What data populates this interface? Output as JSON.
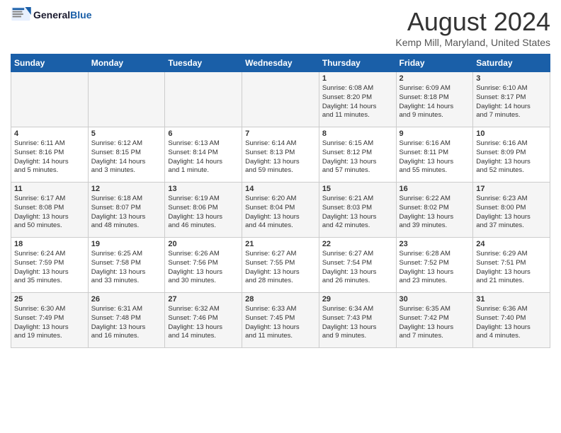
{
  "header": {
    "logo_line1": "General",
    "logo_line2": "Blue",
    "month_year": "August 2024",
    "location": "Kemp Mill, Maryland, United States"
  },
  "weekdays": [
    "Sunday",
    "Monday",
    "Tuesday",
    "Wednesday",
    "Thursday",
    "Friday",
    "Saturday"
  ],
  "weeks": [
    [
      {
        "day": "",
        "info": ""
      },
      {
        "day": "",
        "info": ""
      },
      {
        "day": "",
        "info": ""
      },
      {
        "day": "",
        "info": ""
      },
      {
        "day": "1",
        "info": "Sunrise: 6:08 AM\nSunset: 8:20 PM\nDaylight: 14 hours\nand 11 minutes."
      },
      {
        "day": "2",
        "info": "Sunrise: 6:09 AM\nSunset: 8:18 PM\nDaylight: 14 hours\nand 9 minutes."
      },
      {
        "day": "3",
        "info": "Sunrise: 6:10 AM\nSunset: 8:17 PM\nDaylight: 14 hours\nand 7 minutes."
      }
    ],
    [
      {
        "day": "4",
        "info": "Sunrise: 6:11 AM\nSunset: 8:16 PM\nDaylight: 14 hours\nand 5 minutes."
      },
      {
        "day": "5",
        "info": "Sunrise: 6:12 AM\nSunset: 8:15 PM\nDaylight: 14 hours\nand 3 minutes."
      },
      {
        "day": "6",
        "info": "Sunrise: 6:13 AM\nSunset: 8:14 PM\nDaylight: 14 hours\nand 1 minute."
      },
      {
        "day": "7",
        "info": "Sunrise: 6:14 AM\nSunset: 8:13 PM\nDaylight: 13 hours\nand 59 minutes."
      },
      {
        "day": "8",
        "info": "Sunrise: 6:15 AM\nSunset: 8:12 PM\nDaylight: 13 hours\nand 57 minutes."
      },
      {
        "day": "9",
        "info": "Sunrise: 6:16 AM\nSunset: 8:11 PM\nDaylight: 13 hours\nand 55 minutes."
      },
      {
        "day": "10",
        "info": "Sunrise: 6:16 AM\nSunset: 8:09 PM\nDaylight: 13 hours\nand 52 minutes."
      }
    ],
    [
      {
        "day": "11",
        "info": "Sunrise: 6:17 AM\nSunset: 8:08 PM\nDaylight: 13 hours\nand 50 minutes."
      },
      {
        "day": "12",
        "info": "Sunrise: 6:18 AM\nSunset: 8:07 PM\nDaylight: 13 hours\nand 48 minutes."
      },
      {
        "day": "13",
        "info": "Sunrise: 6:19 AM\nSunset: 8:06 PM\nDaylight: 13 hours\nand 46 minutes."
      },
      {
        "day": "14",
        "info": "Sunrise: 6:20 AM\nSunset: 8:04 PM\nDaylight: 13 hours\nand 44 minutes."
      },
      {
        "day": "15",
        "info": "Sunrise: 6:21 AM\nSunset: 8:03 PM\nDaylight: 13 hours\nand 42 minutes."
      },
      {
        "day": "16",
        "info": "Sunrise: 6:22 AM\nSunset: 8:02 PM\nDaylight: 13 hours\nand 39 minutes."
      },
      {
        "day": "17",
        "info": "Sunrise: 6:23 AM\nSunset: 8:00 PM\nDaylight: 13 hours\nand 37 minutes."
      }
    ],
    [
      {
        "day": "18",
        "info": "Sunrise: 6:24 AM\nSunset: 7:59 PM\nDaylight: 13 hours\nand 35 minutes."
      },
      {
        "day": "19",
        "info": "Sunrise: 6:25 AM\nSunset: 7:58 PM\nDaylight: 13 hours\nand 33 minutes."
      },
      {
        "day": "20",
        "info": "Sunrise: 6:26 AM\nSunset: 7:56 PM\nDaylight: 13 hours\nand 30 minutes."
      },
      {
        "day": "21",
        "info": "Sunrise: 6:27 AM\nSunset: 7:55 PM\nDaylight: 13 hours\nand 28 minutes."
      },
      {
        "day": "22",
        "info": "Sunrise: 6:27 AM\nSunset: 7:54 PM\nDaylight: 13 hours\nand 26 minutes."
      },
      {
        "day": "23",
        "info": "Sunrise: 6:28 AM\nSunset: 7:52 PM\nDaylight: 13 hours\nand 23 minutes."
      },
      {
        "day": "24",
        "info": "Sunrise: 6:29 AM\nSunset: 7:51 PM\nDaylight: 13 hours\nand 21 minutes."
      }
    ],
    [
      {
        "day": "25",
        "info": "Sunrise: 6:30 AM\nSunset: 7:49 PM\nDaylight: 13 hours\nand 19 minutes."
      },
      {
        "day": "26",
        "info": "Sunrise: 6:31 AM\nSunset: 7:48 PM\nDaylight: 13 hours\nand 16 minutes."
      },
      {
        "day": "27",
        "info": "Sunrise: 6:32 AM\nSunset: 7:46 PM\nDaylight: 13 hours\nand 14 minutes."
      },
      {
        "day": "28",
        "info": "Sunrise: 6:33 AM\nSunset: 7:45 PM\nDaylight: 13 hours\nand 11 minutes."
      },
      {
        "day": "29",
        "info": "Sunrise: 6:34 AM\nSunset: 7:43 PM\nDaylight: 13 hours\nand 9 minutes."
      },
      {
        "day": "30",
        "info": "Sunrise: 6:35 AM\nSunset: 7:42 PM\nDaylight: 13 hours\nand 7 minutes."
      },
      {
        "day": "31",
        "info": "Sunrise: 6:36 AM\nSunset: 7:40 PM\nDaylight: 13 hours\nand 4 minutes."
      }
    ]
  ]
}
